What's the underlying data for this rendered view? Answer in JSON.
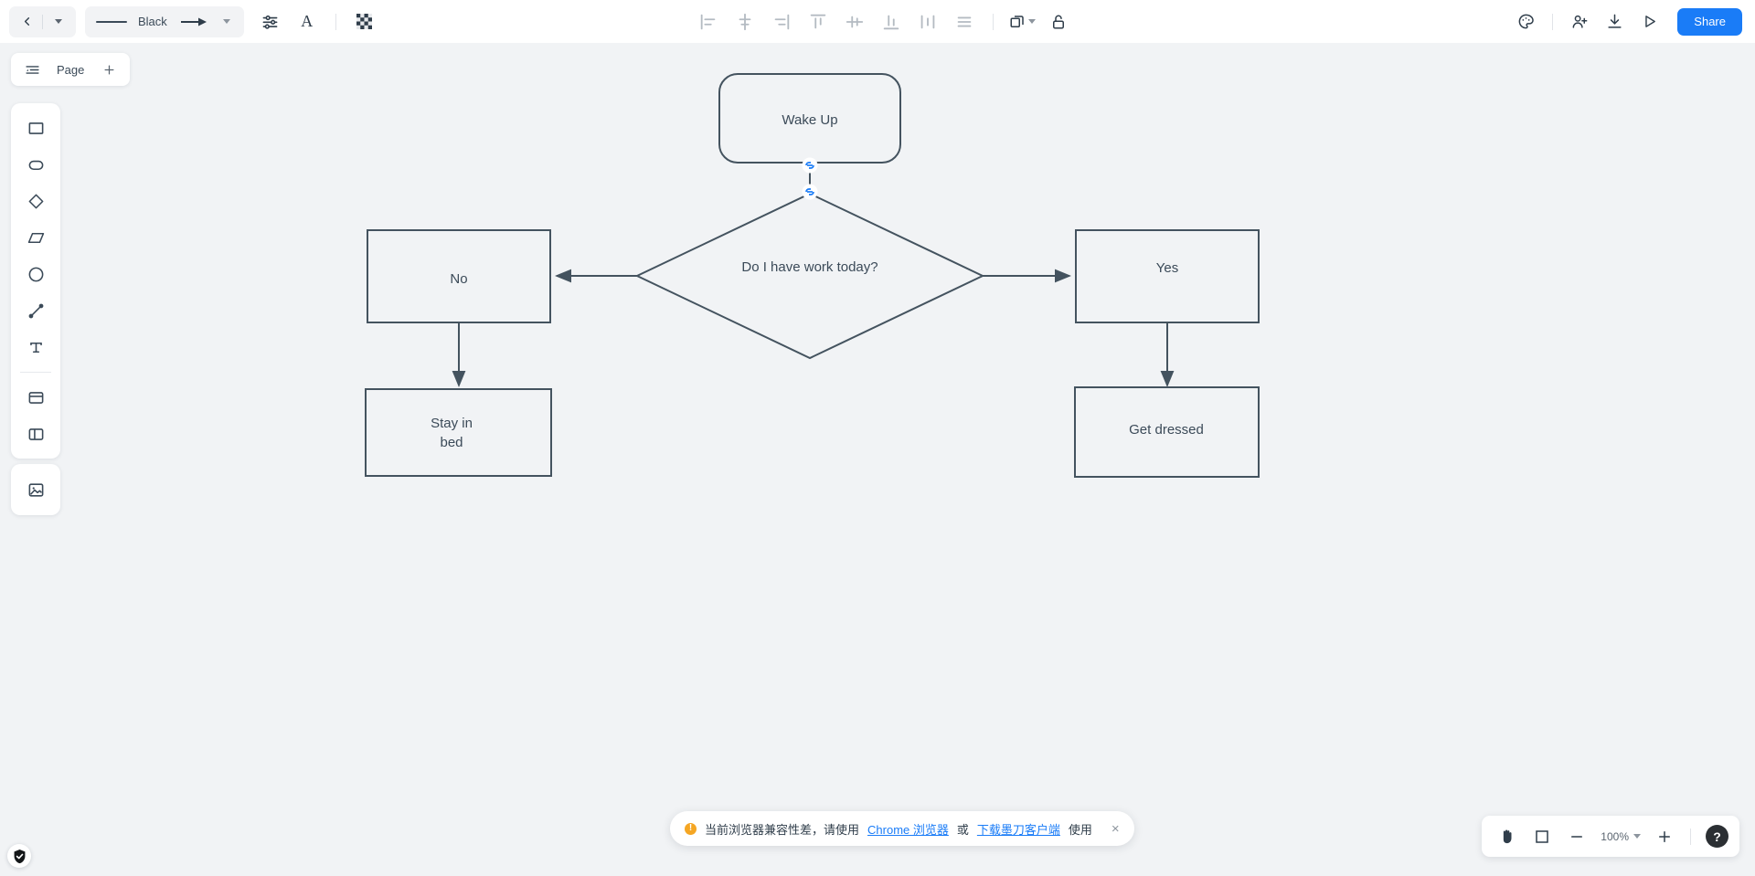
{
  "toolbar": {
    "back_label": "back",
    "back_dropdown_label": "history-dropdown",
    "stroke_label": "stroke",
    "color_label": "Black",
    "arrow_label": "arrow-style",
    "settings_label": "shape-settings",
    "text_format_label": "A",
    "fill_label": "fill-pattern",
    "align_left": "align-left",
    "align_center_h": "align-center-horizontal",
    "align_right": "align-right",
    "align_top": "align-top",
    "align_middle_v": "align-middle-vertical",
    "align_bottom": "align-bottom",
    "distribute_h": "distribute-horizontal",
    "distribute_v": "distribute-vertical",
    "layers_label": "layers",
    "lock_label": "lock",
    "theme_label": "theme",
    "invite_label": "invite-collaborator",
    "download_label": "download",
    "present_label": "present",
    "share_label": "Share"
  },
  "pagebar": {
    "outline_label": "page-outline",
    "page_label": "Page",
    "add_label": "add-page"
  },
  "rail": {
    "items": [
      {
        "name": "rectangle",
        "label": "Rectangle"
      },
      {
        "name": "rounded-rectangle",
        "label": "Rounded Rectangle"
      },
      {
        "name": "diamond",
        "label": "Diamond"
      },
      {
        "name": "parallelogram",
        "label": "Parallelogram"
      },
      {
        "name": "circle",
        "label": "Circle"
      },
      {
        "name": "line",
        "label": "Line"
      },
      {
        "name": "text",
        "label": "Text"
      },
      {
        "name": "card",
        "label": "Card"
      },
      {
        "name": "split-layout",
        "label": "Split Layout"
      }
    ],
    "image_label": "Image"
  },
  "chart_data": {
    "type": "diagram",
    "title": "Morning routine flowchart",
    "nodes": [
      {
        "id": "wake",
        "label": "Wake Up",
        "shape": "rounded-rectangle"
      },
      {
        "id": "decide",
        "label": "Do I have work today?",
        "shape": "diamond"
      },
      {
        "id": "no",
        "label": "No",
        "shape": "rectangle"
      },
      {
        "id": "yes",
        "label": "Yes",
        "shape": "rectangle"
      },
      {
        "id": "staybed",
        "label": "Stay in\nbed",
        "shape": "rectangle",
        "lines": [
          "Stay in",
          "bed"
        ]
      },
      {
        "id": "dressed",
        "label": "Get dressed",
        "shape": "rectangle"
      }
    ],
    "edges": [
      {
        "from": "wake",
        "to": "decide",
        "selected": true
      },
      {
        "from": "decide",
        "to": "no",
        "selected": false
      },
      {
        "from": "decide",
        "to": "yes",
        "selected": false
      },
      {
        "from": "no",
        "to": "staybed",
        "selected": false
      },
      {
        "from": "yes",
        "to": "dressed",
        "selected": false
      }
    ],
    "stroke_color": "#44535f",
    "fill_color": "#f1f3f5",
    "selection_color": "#1a7cf7",
    "canvas_color": "#f1f3f5"
  },
  "toast": {
    "text_before": "当前浏览器兼容性差，请使用",
    "link1": "Chrome 浏览器",
    "text_middle": "或",
    "link2": "下载墨刀客户端",
    "text_after": "使用",
    "close_label": "×"
  },
  "zoombar": {
    "hand_label": "pan-tool",
    "fit_label": "fit-to-screen",
    "zoom_out_label": "zoom-out",
    "zoom_value": "100%",
    "zoom_in_label": "zoom-in",
    "help_label": "?"
  },
  "security": {
    "badge_label": "secure-connection"
  }
}
